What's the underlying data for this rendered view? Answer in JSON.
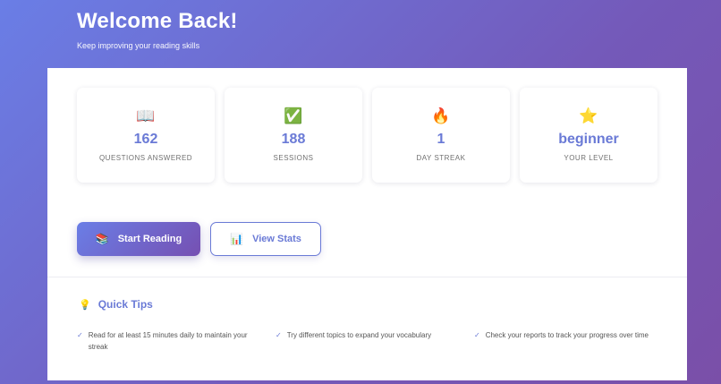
{
  "header": {
    "title": "Welcome Back!",
    "subtitle": "Keep improving your reading skills"
  },
  "stats": [
    {
      "icon": "📖",
      "icon_name": "book-icon",
      "value": "162",
      "label": "QUESTIONS ANSWERED"
    },
    {
      "icon": "✅",
      "icon_name": "check-icon",
      "value": "188",
      "label": "SESSIONS"
    },
    {
      "icon": "🔥",
      "icon_name": "fire-icon",
      "value": "1",
      "label": "DAY STREAK"
    },
    {
      "icon": "⭐",
      "icon_name": "star-icon",
      "value": "beginner",
      "label": "YOUR LEVEL"
    }
  ],
  "actions": {
    "start_icon": "📚",
    "start_label": "Start Reading",
    "stats_icon": "📊",
    "stats_label": "View Stats"
  },
  "tips": {
    "icon": "💡",
    "title": "Quick Tips",
    "check": "✓",
    "items": [
      "Read for at least 15 minutes daily to maintain your streak",
      "Try different topics to expand your vocabulary",
      "Check your reports to track your progress over time"
    ]
  },
  "colors": {
    "accent": "#6a7ad6",
    "gradient_start": "#6a7ee6",
    "gradient_end": "#7650b2"
  }
}
